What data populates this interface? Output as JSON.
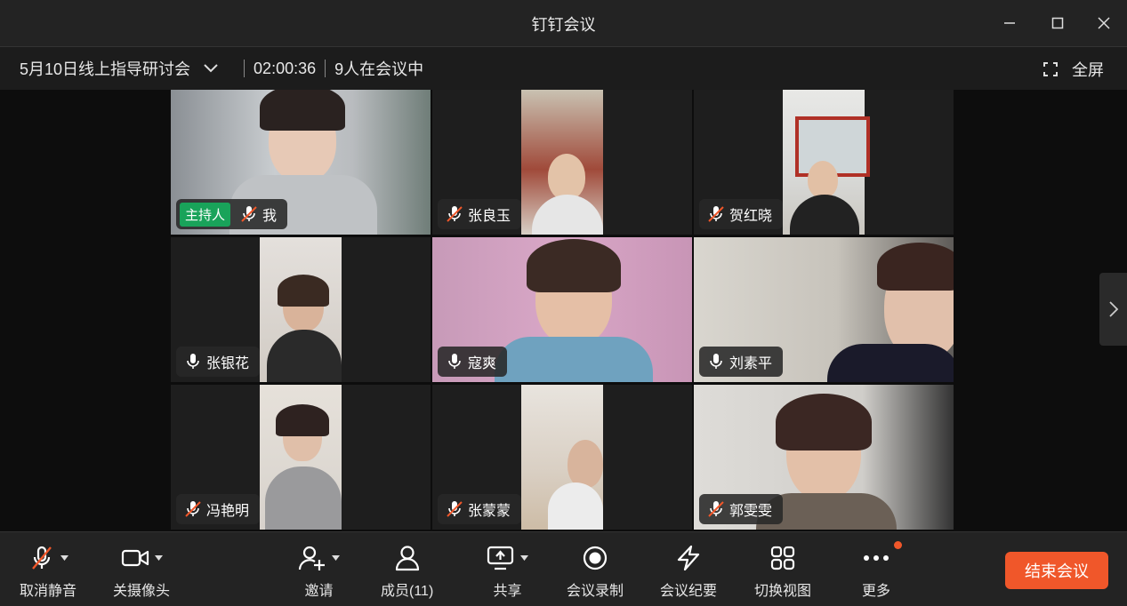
{
  "window": {
    "title": "钉钉会议"
  },
  "infobar": {
    "meeting_title": "5月10日线上指导研讨会",
    "duration": "02:00:36",
    "attendee_count": "9人在会议中",
    "fullscreen_label": "全屏"
  },
  "participants": [
    {
      "name": "我",
      "host_badge": "主持人",
      "mic": "muted"
    },
    {
      "name": "张良玉",
      "mic": "muted"
    },
    {
      "name": "贺红晓",
      "mic": "muted"
    },
    {
      "name": "张银花",
      "mic": "on"
    },
    {
      "name": "寇爽",
      "mic": "on",
      "speaking": true
    },
    {
      "name": "刘素平",
      "mic": "on"
    },
    {
      "name": "冯艳明",
      "mic": "muted"
    },
    {
      "name": "张蒙蒙",
      "mic": "muted"
    },
    {
      "name": "郭雯雯",
      "mic": "muted"
    }
  ],
  "toolbar": {
    "unmute": "取消静音",
    "camera_off": "关摄像头",
    "invite": "邀请",
    "members": "成员(11)",
    "share": "共享",
    "record": "会议录制",
    "minutes": "会议纪要",
    "switch_view": "切换视图",
    "more": "更多",
    "end_meeting": "结束会议"
  },
  "colors": {
    "accent_end": "#f0572a",
    "speaking_border": "#1fa857",
    "host_badge": "#19a35a"
  }
}
